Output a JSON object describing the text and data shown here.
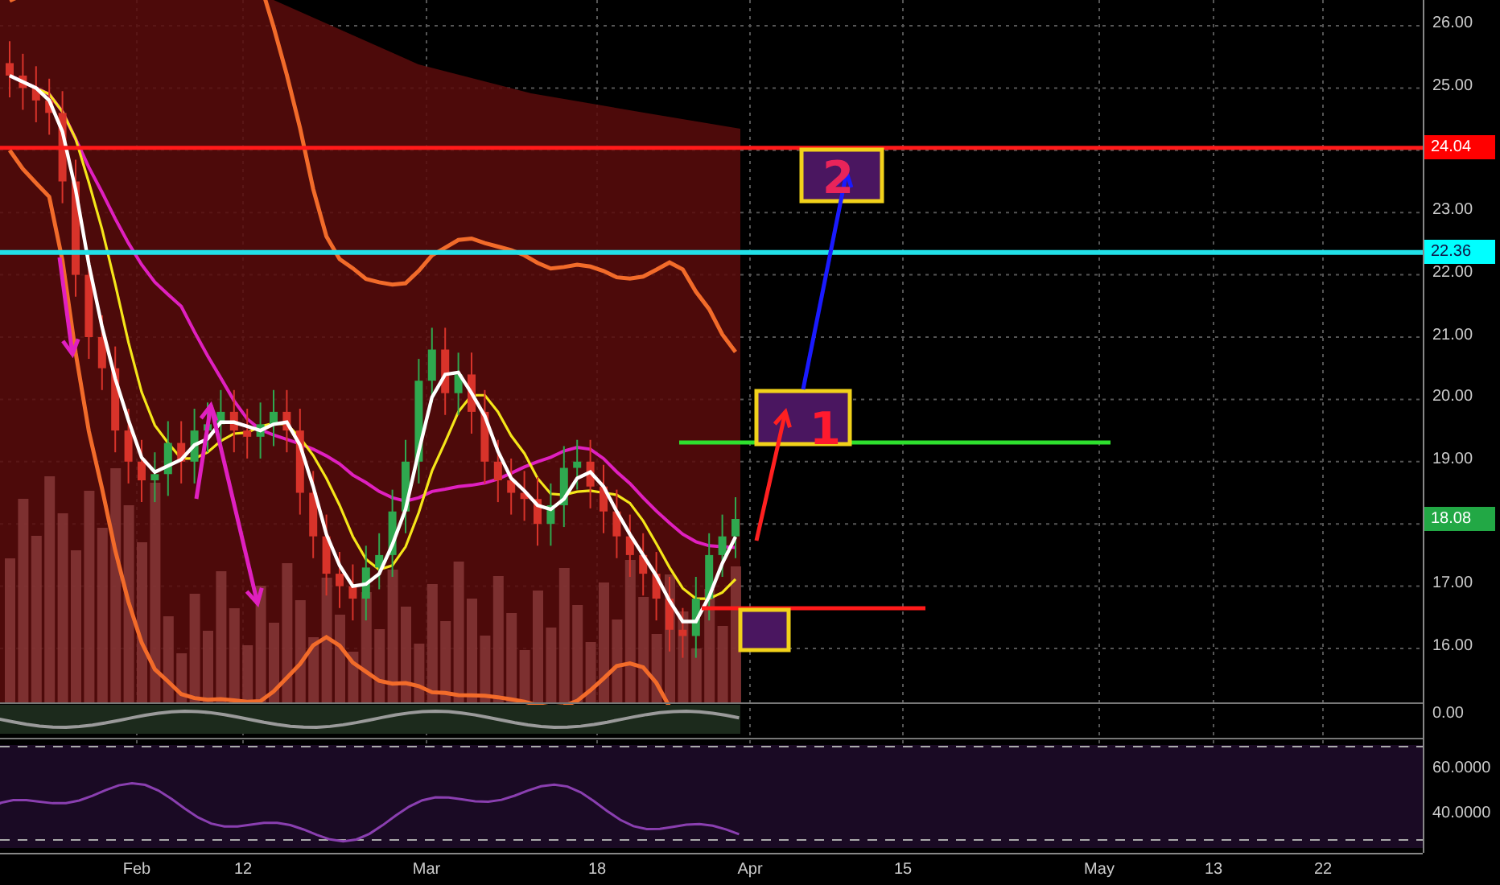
{
  "price_axis": {
    "ticks": [
      "26.00",
      "25.00",
      "23.00",
      "22.00",
      "21.00",
      "20.00",
      "19.00",
      "17.00",
      "16.00"
    ]
  },
  "price_labels": [
    {
      "text": "24.04",
      "color": "#ff0000"
    },
    {
      "text": "22.36",
      "color": "#00ffff"
    },
    {
      "text": "18.08",
      "color": "#22a845"
    }
  ],
  "oscillator_axis": {
    "ticks": [
      "0.00"
    ]
  },
  "rsi_axis": {
    "ticks": [
      "60.0000",
      "40.0000"
    ]
  },
  "time_axis": {
    "ticks": [
      "Feb",
      "12",
      "Mar",
      "18",
      "Apr",
      "15",
      "May",
      "13",
      "22"
    ]
  },
  "annotations": [
    {
      "text": "2"
    },
    {
      "text": "1"
    }
  ]
}
